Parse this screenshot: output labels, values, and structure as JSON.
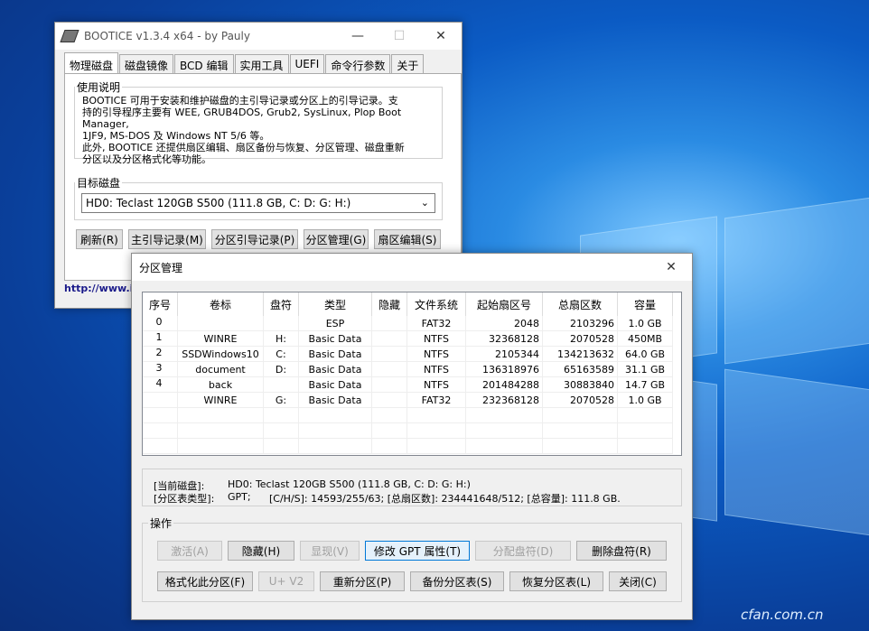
{
  "desktop": {
    "watermark": "cfan.com.cn"
  },
  "bootice": {
    "title": "BOOTICE v1.3.4 x64 - by Pauly",
    "tabs": [
      "物理磁盘",
      "磁盘镜像",
      "BCD 编辑",
      "实用工具",
      "UEFI",
      "命令行参数",
      "关于"
    ],
    "usage_legend": "使用说明",
    "usage_lines": [
      "BOOTICE 可用于安装和维护磁盘的主引导记录或分区上的引导记录。支",
      "持的引导程序主要有 WEE, GRUB4DOS, Grub2, SysLinux, Plop Boot Manager,",
      "1JF9, MS-DOS 及 Windows NT 5/6 等。",
      "此外, BOOTICE 还提供扇区编辑、扇区备份与恢复、分区管理、磁盘重新",
      "分区以及分区格式化等功能。"
    ],
    "target_legend": "目标磁盘",
    "target_disk": "HD0: Teclast 120GB S500 (111.8 GB, C: D: G: H:)",
    "buttons": {
      "refresh": "刷新(R)",
      "mbr": "主引导记录(M)",
      "pbr": "分区引导记录(P)",
      "partmgr": "分区管理(G)",
      "sector": "扇区编辑(S)"
    },
    "link": "http://www.ip"
  },
  "partition": {
    "title": "分区管理",
    "columns": [
      "序号",
      "卷标",
      "盘符",
      "类型",
      "隐藏",
      "文件系统",
      "起始扇区号",
      "总扇区数",
      "容量"
    ],
    "index_labels": [
      "0",
      "1",
      "2",
      "3",
      "4"
    ],
    "rows": [
      {
        "label": "",
        "drive": "",
        "type": "ESP",
        "hidden": "",
        "fs": "FAT32",
        "start": "2048",
        "total": "2103296",
        "size": "1.0 GB"
      },
      {
        "label": "WINRE",
        "drive": "H:",
        "type": "Basic Data",
        "hidden": "",
        "fs": "NTFS",
        "start": "32368128",
        "total": "2070528",
        "size": "450MB"
      },
      {
        "label": "SSDWindows10",
        "drive": "C:",
        "type": "Basic Data",
        "hidden": "",
        "fs": "NTFS",
        "start": "2105344",
        "total": "134213632",
        "size": "64.0 GB"
      },
      {
        "label": "document",
        "drive": "D:",
        "type": "Basic Data",
        "hidden": "",
        "fs": "NTFS",
        "start": "136318976",
        "total": "65163589",
        "size": "31.1 GB"
      },
      {
        "label": "back",
        "drive": "",
        "type": "Basic Data",
        "hidden": "",
        "fs": "NTFS",
        "start": "201484288",
        "total": "30883840",
        "size": "14.7 GB"
      },
      {
        "label": "WINRE",
        "drive": "G:",
        "type": "Basic Data",
        "hidden": "",
        "fs": "FAT32",
        "start": "232368128",
        "total": "2070528",
        "size": "1.0 GB"
      }
    ],
    "info": {
      "cur_key": "[当前磁盘]:",
      "cur_val": "HD0: Teclast 120GB S500 (111.8 GB, C: D: G: H:)",
      "type_key": "[分区表类型]:",
      "type_val": "GPT;",
      "geo": "[C/H/S]: 14593/255/63; [总扇区数]: 234441648/512; [总容量]: 111.8 GB."
    },
    "ops_legend": "操作",
    "buttons": {
      "activate": "激活(A)",
      "hide": "隐藏(H)",
      "show": "显现(V)",
      "gpt_attr": "修改 GPT 属性(T)",
      "assign": "分配盘符(D)",
      "remove": "删除盘符(R)",
      "format": "格式化此分区(F)",
      "uv2": "U+ V2",
      "repartition": "重新分区(P)",
      "backup": "备份分区表(S)",
      "restore": "恢复分区表(L)",
      "close": "关闭(C)"
    }
  }
}
